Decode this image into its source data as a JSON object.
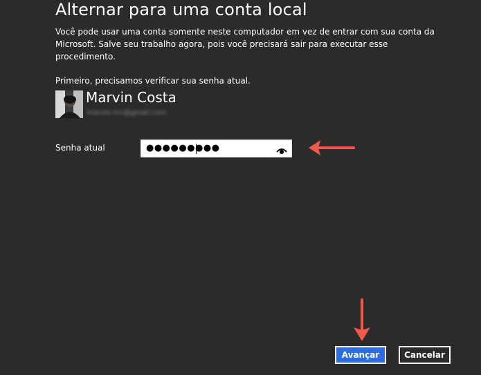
{
  "page": {
    "title": "Alternar para uma conta local",
    "description_1": "Você pode usar uma conta somente neste computador em vez de entrar com sua conta da Microsoft. Salve seu trabalho agora, pois você precisará sair para executar esse procedimento.",
    "description_2": "Primeiro, precisamos verificar sua senha atual."
  },
  "account": {
    "name": "Marvin Costa",
    "email": "marvin.rcc@gmail.com"
  },
  "password": {
    "label": "Senha atual",
    "value": "●●●●●●●●●",
    "reveal_icon": "eye-icon"
  },
  "buttons": {
    "next_label": "Avançar",
    "cancel_label": "Cancelar"
  },
  "colors": {
    "background": "#2b2b2b",
    "accent": "#2e6de0",
    "annotation_arrow": "#f0584a"
  }
}
